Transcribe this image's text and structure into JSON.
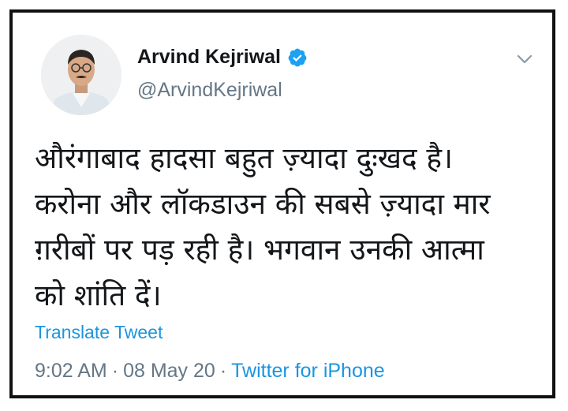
{
  "tweet": {
    "author": {
      "name": "Arvind Kejriwal",
      "handle": "@ArvindKejriwal",
      "verified": true,
      "avatar_icon": "profile-photo"
    },
    "text_lines": [
      "औरंगाबाद हादसा बहुत ज़्यादा दुःखद है।",
      "करोना और लॉकडाउन की सबसे ज़्यादा मार",
      "ग़रीबों पर पड़ रही है। भगवान उनकी आत्मा",
      "को शांति दें।"
    ],
    "translate_label": "Translate Tweet",
    "time": "9:02 AM",
    "date": "08 May 20",
    "separator": "·",
    "source": "Twitter for iPhone",
    "colors": {
      "link": "#1b95e0",
      "muted": "#657786",
      "text": "#14171a",
      "border": "#111111"
    },
    "icons": {
      "verified": "verified-badge-icon",
      "menu": "chevron-down-icon"
    }
  }
}
